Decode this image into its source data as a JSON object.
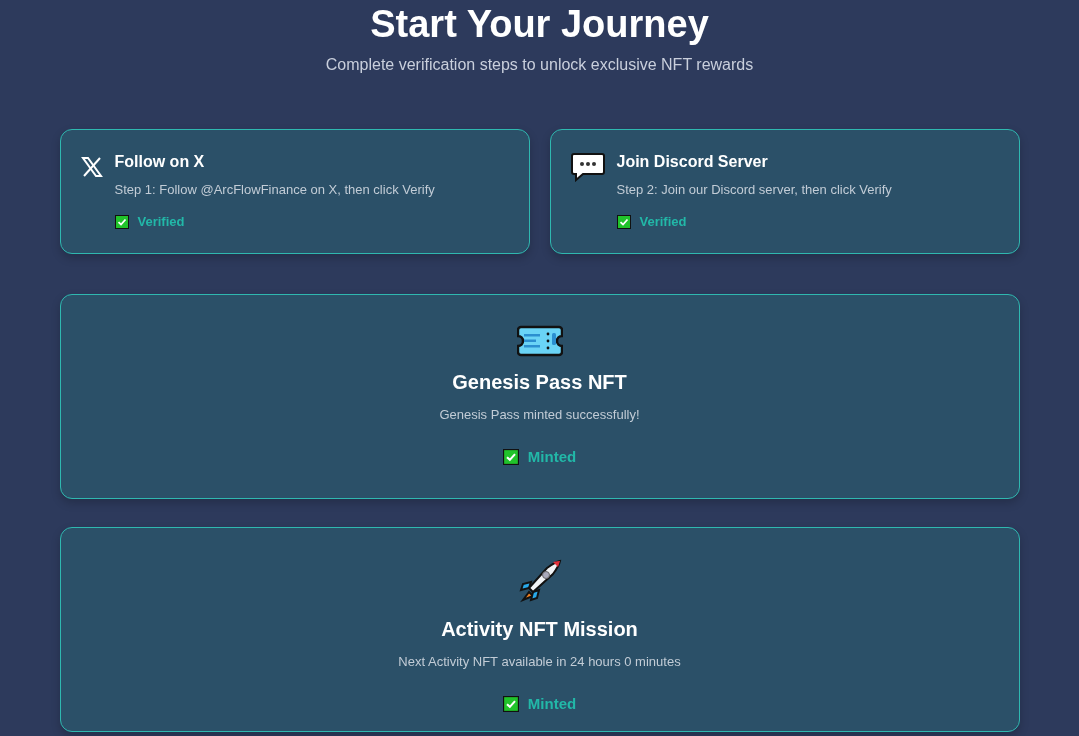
{
  "header": {
    "title": "Start Your Journey",
    "subtitle": "Complete verification steps to unlock exclusive NFT rewards"
  },
  "tasks": [
    {
      "title": "Follow on X",
      "description": "Step 1: Follow @ArcFlowFinance on X, then click Verify",
      "done": true,
      "status": "Verified"
    },
    {
      "title": "Join Discord Server",
      "description": "Step 2: Join our Discord server, then click Verify",
      "done": true,
      "status": "Verified"
    }
  ],
  "missions": [
    {
      "title": "Genesis Pass NFT",
      "description": "Genesis Pass minted successfully!",
      "done": true,
      "status": "Minted"
    },
    {
      "title": "Activity NFT Mission",
      "description": "Next Activity NFT available in 24 hours 0 minutes",
      "done": true,
      "status": "Minted"
    }
  ]
}
